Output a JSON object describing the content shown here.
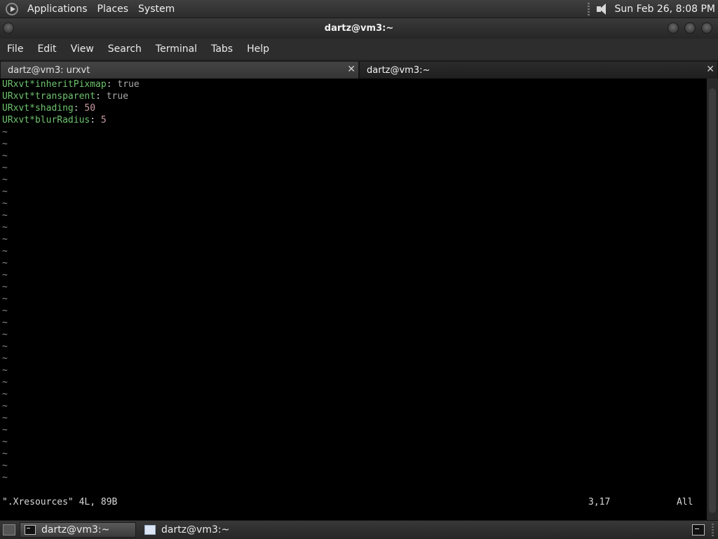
{
  "top_panel": {
    "menus": [
      "Applications",
      "Places",
      "System"
    ],
    "clock": "Sun Feb 26,  8:08 PM",
    "icons": {
      "logo": "distro-logo-icon",
      "volume": "volume-icon"
    }
  },
  "window": {
    "title": "dartz@vm3:~"
  },
  "menu_bar": {
    "items": [
      "File",
      "Edit",
      "View",
      "Search",
      "Terminal",
      "Tabs",
      "Help"
    ]
  },
  "tabs": [
    {
      "label": "dartz@vm3: urxvt",
      "active": false
    },
    {
      "label": "dartz@vm3:~",
      "active": true
    }
  ],
  "terminal": {
    "lines": [
      {
        "key": "URxvt*inheritPixmap",
        "sep": ": ",
        "value": "true"
      },
      {
        "key": "URxvt*transparent",
        "sep": ": ",
        "value": "true"
      },
      {
        "key": "URxvt*shading",
        "sep": ": ",
        "value": "50"
      },
      {
        "key": "URxvt*blurRadius",
        "sep": ": ",
        "value": "5"
      }
    ],
    "empty_marker": "~",
    "empty_count": 30,
    "status": {
      "file_info": "\".Xresources\" 4L, 89B",
      "cursor_pos": "3,17",
      "scroll": "All"
    },
    "colors": {
      "key": "#6ec36e",
      "value": "#a8a8a8",
      "number": "#c89aa0"
    }
  },
  "bottom_panel": {
    "tasks": [
      {
        "label": "dartz@vm3:~",
        "active": true,
        "icon": "terminal-icon"
      },
      {
        "label": "dartz@vm3:~",
        "active": false,
        "icon": "window-icon"
      }
    ]
  }
}
